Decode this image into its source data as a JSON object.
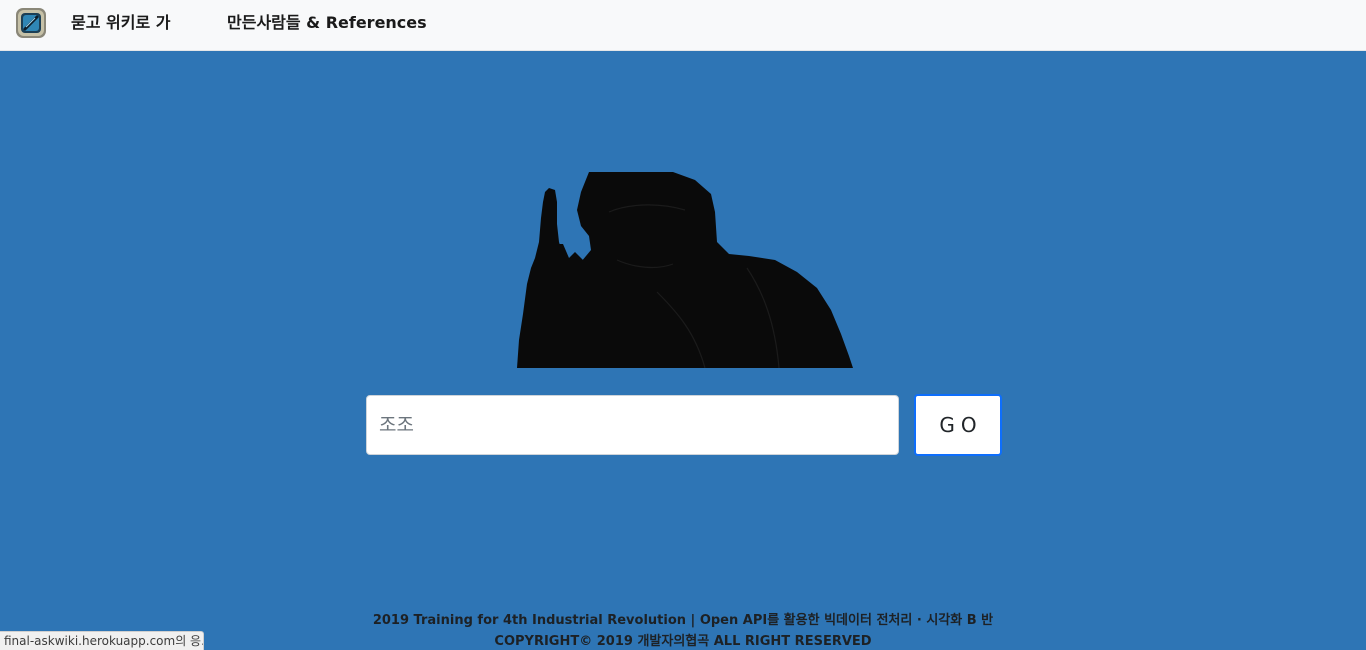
{
  "navbar": {
    "logo_icon": "askwiki-logo-icon",
    "brand_label": "묻고 위키로 가",
    "credits_label": "만든사람들 & References"
  },
  "hero": {
    "silhouette_icon": "pointing-man-silhouette",
    "search": {
      "value": "",
      "placeholder": "조조"
    },
    "go_label": "GO",
    "background_color": "#2e75b5",
    "button_border_color": "#0d6efd"
  },
  "footer": {
    "line1": "2019 Training for 4th Industrial Revolution | Open API를 활용한 빅데이터 전처리 · 시각화 B 반",
    "line2": "COPYRIGHT© 2019 개발자의협곡 ALL RIGHT RESERVED"
  },
  "status_bar": {
    "text": "final-askwiki.herokuapp.com의 응..."
  }
}
